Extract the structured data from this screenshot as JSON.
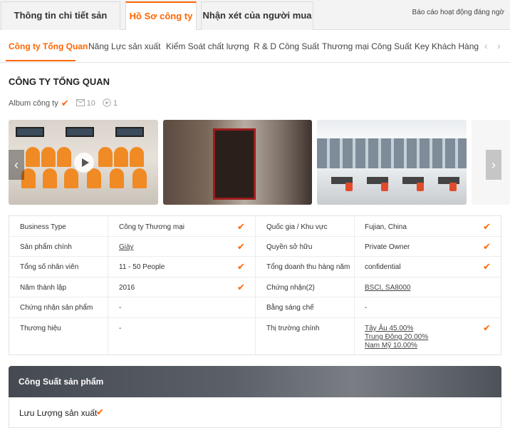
{
  "top_tabs": [
    {
      "label": "Thông tin chi tiết sản phẩm"
    },
    {
      "label": "Hồ Sơ công ty"
    },
    {
      "label": "Nhận xét của người mua"
    }
  ],
  "report_link": "Báo cáo hoạt động đáng ngờ",
  "sub_nav": [
    {
      "label": "Công ty Tổng Quan"
    },
    {
      "label": "Năng Lực sản xuất"
    },
    {
      "label": "Kiểm Soát chất lượng"
    },
    {
      "label": "R & D Công Suất"
    },
    {
      "label": "Thương mại Công Suất"
    },
    {
      "label": "Key Khách Hàng"
    }
  ],
  "page_title": "CÔNG TY TỔNG QUAN",
  "album": {
    "label": "Album công ty",
    "photo_count": "10",
    "video_count": "1"
  },
  "info": {
    "left": [
      {
        "label": "Business Type",
        "value": "Công ty Thương mại",
        "verified": true
      },
      {
        "label": "Sản phẩm chính",
        "value": "Giày",
        "verified": true
      },
      {
        "label": "Tổng số nhân viên",
        "value": "11 - 50 People",
        "verified": true
      },
      {
        "label": "Năm thành lập",
        "value": "2016",
        "verified": true
      },
      {
        "label": "Chứng nhận sản phẩm",
        "value": "-",
        "verified": false
      },
      {
        "label": "Thương hiệu",
        "value": "-",
        "verified": false
      }
    ],
    "right": [
      {
        "label": "Quốc gia / Khu vực",
        "value": "Fujian, China",
        "verified": true
      },
      {
        "label": "Quyền sở hữu",
        "value": "Private Owner",
        "verified": true
      },
      {
        "label": "Tổng doanh thu hàng năm",
        "value": "confidential",
        "verified": true
      },
      {
        "label": "Chứng nhận(2)",
        "value": "BSCI, SA8000",
        "verified": false
      },
      {
        "label": "Bằng sáng chế",
        "value": "-",
        "verified": false
      },
      {
        "label": "Thị trường chính",
        "markets": [
          "Tây Âu 45.00%",
          "Trung Đông 20.00%",
          "Nam Mỹ 10.00%"
        ],
        "verified": true
      }
    ]
  },
  "capacity": {
    "title": "Công Suất sản phẩm",
    "flow_label": "Lưu Lượng sản xuất"
  },
  "icons": {
    "check": "✔",
    "mail": "mail-icon",
    "play": "play-icon"
  },
  "colors": {
    "accent": "#ff6600"
  }
}
